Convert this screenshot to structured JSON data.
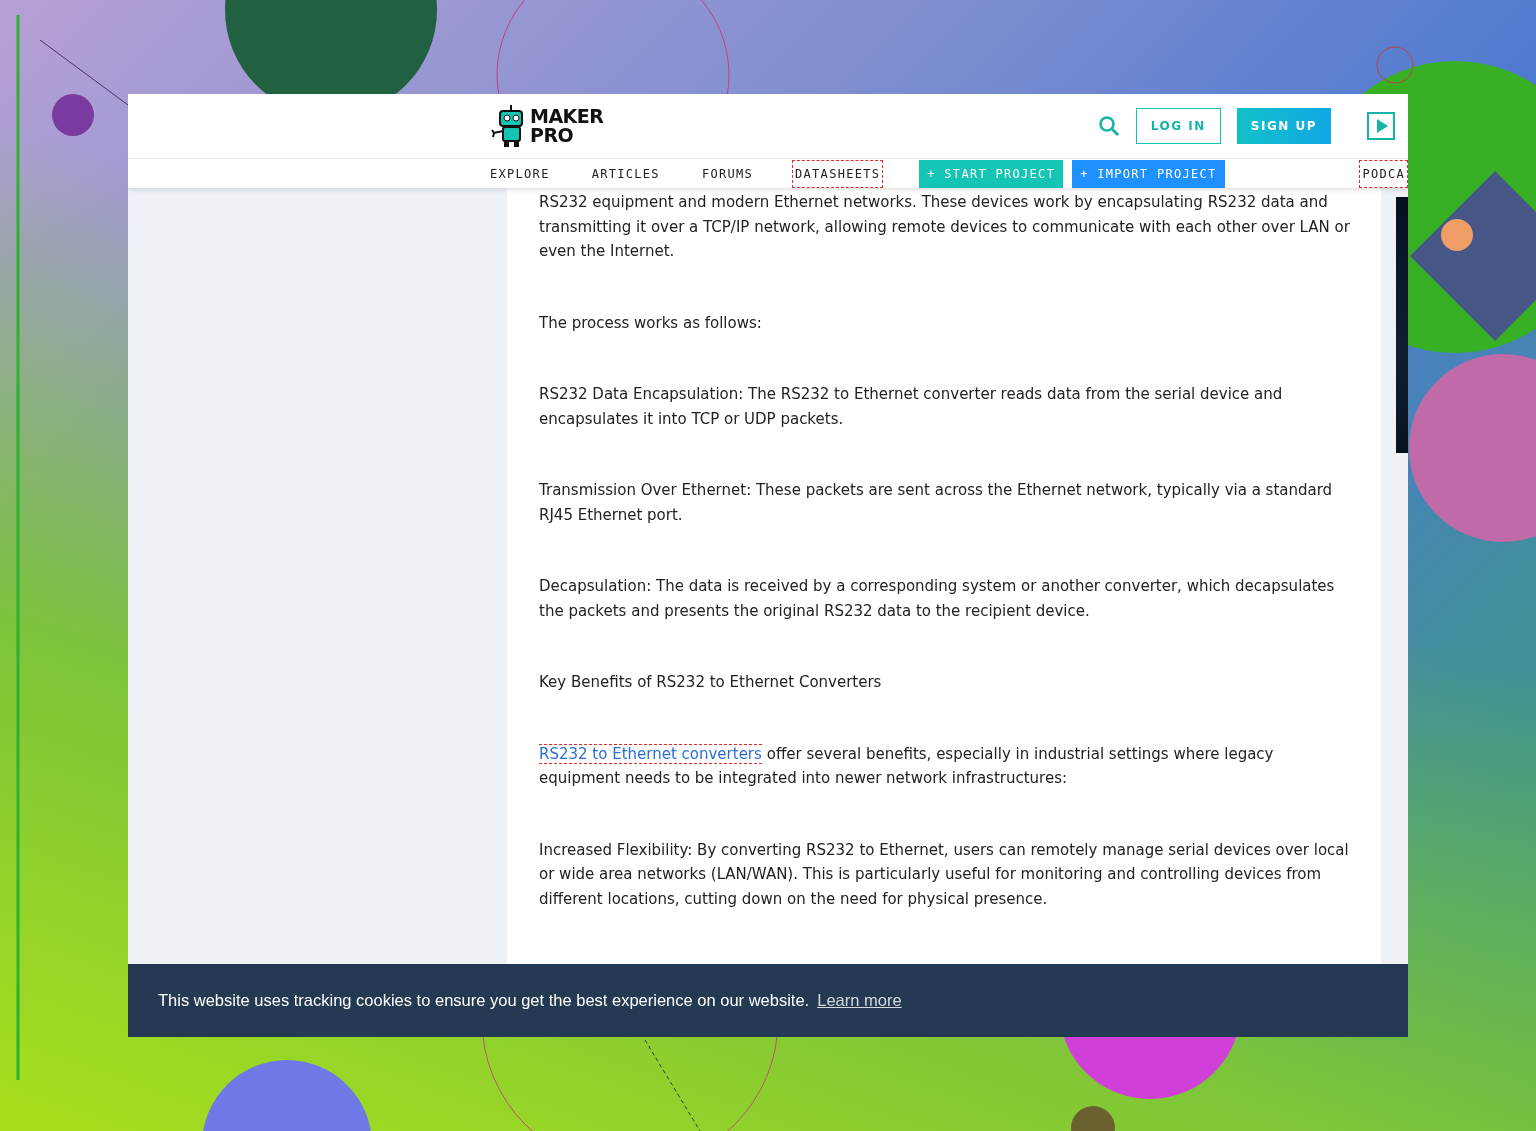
{
  "header": {
    "logo": "MAKER PRO",
    "login": "LOG IN",
    "signup": "SIGN UP"
  },
  "nav": [
    {
      "label": "EXPLORE",
      "kind": "link",
      "outlined": false
    },
    {
      "label": "ARTICLES",
      "kind": "link",
      "outlined": false
    },
    {
      "label": "FORUMS",
      "kind": "link",
      "outlined": false
    },
    {
      "label": "DATASHEETS",
      "kind": "link",
      "outlined": true
    },
    {
      "label": "+ START PROJECT",
      "kind": "start"
    },
    {
      "label": "+ IMPORT PROJECT",
      "kind": "import"
    },
    {
      "label": "PODCA",
      "kind": "link",
      "outlined": true
    }
  ],
  "article": [
    {
      "text": "RS232 equipment and modern Ethernet networks. These devices work by encapsulating RS232 data and transmitting it over a TCP/IP network, allowing remote devices to communicate with each other over LAN or even the Internet."
    },
    {
      "text": "The process works as follows:"
    },
    {
      "text": "RS232 Data Encapsulation: The RS232 to Ethernet converter reads data from the serial device and encapsulates it into TCP or UDP packets."
    },
    {
      "text": "Transmission Over Ethernet: These packets are sent across the Ethernet network, typically via a standard RJ45 Ethernet port."
    },
    {
      "text": "Decapsulation: The data is received by a corresponding system or another converter, which decapsulates the packets and presents the original RS232 data to the recipient device."
    },
    {
      "text": "Key Benefits of RS232 to Ethernet Converters"
    },
    {
      "link": "RS232 to Ethernet converters",
      "link_outlined": true,
      "text": "offer several benefits, especially in industrial settings where legacy equipment needs to be integrated into newer network infrastructures:"
    },
    {
      "text": "Increased Flexibility: By converting RS232 to Ethernet, users can remotely manage serial devices over local or wide area networks (LAN/WAN). This is particularly useful for monitoring and controlling devices from different locations, cutting down on the need for physical presence."
    }
  ],
  "cookie": {
    "text": "This website uses tracking cookies to ensure you get the best experience on our website.",
    "link": "Learn more"
  }
}
